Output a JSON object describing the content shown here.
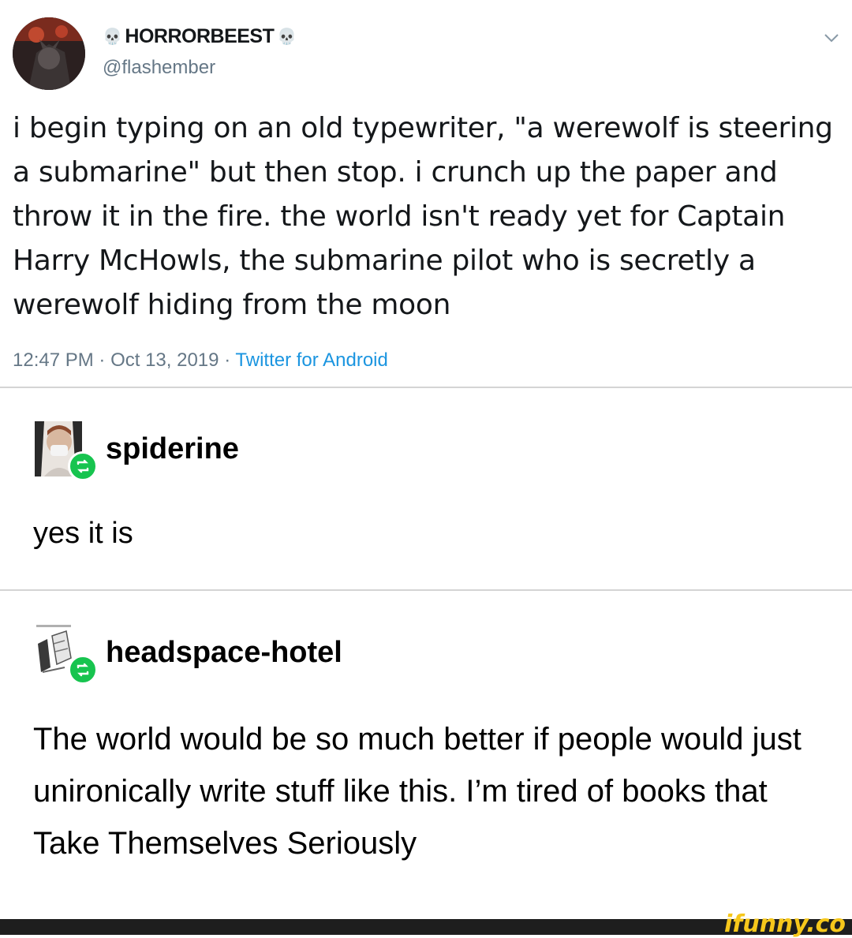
{
  "tweet": {
    "display_name": "HORRORBEEST",
    "name_emoji": "💀",
    "handle": "@flashember",
    "text": "i begin typing on an old typewriter, \"a werewolf is steering a submarine\" but then stop. i crunch up the paper and throw it in the fire. the world isn't ready yet for Captain Harry McHowls, the submarine pilot who is secretly a werewolf hiding from the moon",
    "time": "12:47 PM",
    "date": "Oct 13, 2019",
    "separator": "·",
    "source": "Twitter for Android"
  },
  "posts": [
    {
      "username": "spiderine",
      "text": "yes it is"
    },
    {
      "username": "headspace-hotel",
      "text": "The world would be so much better if people would just unironically write stuff like this. I’m tired of books that Take Themselves Seriously"
    }
  ],
  "watermark": "ifunny.co",
  "colors": {
    "reblog_green": "#17c44f",
    "link_blue": "#1b95e0",
    "muted_gray": "#657786",
    "watermark_yellow": "#f6c71b"
  }
}
